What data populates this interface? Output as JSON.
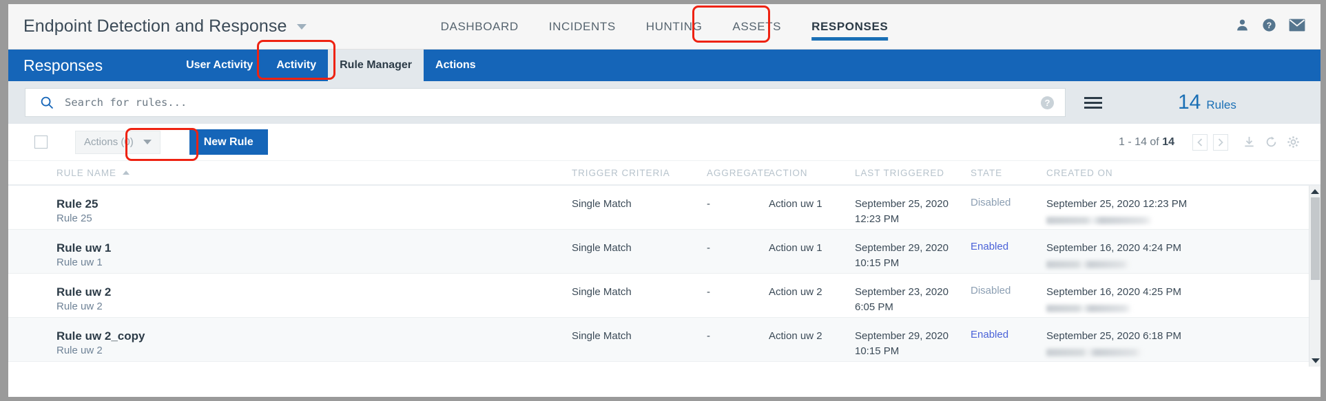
{
  "header": {
    "brand_title": "Endpoint Detection and Response",
    "brand_caret_icon": "chevron-down-icon",
    "nav": [
      {
        "label": "DASHBOARD",
        "active": false
      },
      {
        "label": "INCIDENTS",
        "active": false
      },
      {
        "label": "HUNTING",
        "active": false
      },
      {
        "label": "ASSETS",
        "active": false
      },
      {
        "label": "RESPONSES",
        "active": true
      }
    ],
    "icons": [
      {
        "name": "user-icon"
      },
      {
        "name": "help-icon"
      },
      {
        "name": "mail-icon"
      }
    ]
  },
  "subnav": {
    "title": "Responses",
    "tabs": [
      {
        "label": "User Activity",
        "active": false
      },
      {
        "label": "Activity",
        "active": false
      },
      {
        "label": "Rule Manager",
        "active": true
      },
      {
        "label": "Actions",
        "active": false
      }
    ]
  },
  "search": {
    "placeholder": "Search for rules...",
    "value": "",
    "icon": "search-icon",
    "help_label": "?",
    "menu_icon": "hamburger-icon"
  },
  "rules_counter": {
    "count": "14",
    "label": "Rules"
  },
  "toolbar": {
    "select_all_checkbox": "",
    "actions_label": "Actions (0)",
    "actions_caret_icon": "chevron-down-icon",
    "new_rule_label": "New Rule"
  },
  "pager": {
    "range_prefix": "1 - 14 of ",
    "total": "14",
    "prev_icon": "chevron-left-icon",
    "next_icon": "chevron-right-icon",
    "download_icon": "download-icon",
    "refresh_icon": "refresh-icon",
    "settings_icon": "gear-icon"
  },
  "table": {
    "columns": [
      {
        "key": "name",
        "label": "RULE NAME",
        "sorted": true
      },
      {
        "key": "trigger",
        "label": "TRIGGER CRITERIA",
        "sorted": false
      },
      {
        "key": "agg",
        "label": "AGGREGATE",
        "sorted": false
      },
      {
        "key": "action",
        "label": "ACTION",
        "sorted": false
      },
      {
        "key": "last",
        "label": "LAST TRIGGERED",
        "sorted": false
      },
      {
        "key": "state",
        "label": "STATE",
        "sorted": false
      },
      {
        "key": "created",
        "label": "CREATED ON",
        "sorted": false
      }
    ],
    "sort_caret_icon": "sort-asc-icon",
    "rows": [
      {
        "name": "Rule 25",
        "subtitle": "Rule 25",
        "trigger": "Single Match",
        "aggregate": "-",
        "action": "Action uw 1",
        "last_triggered_date": "September 25, 2020",
        "last_triggered_time": "12:23 PM",
        "state": "Disabled",
        "created_on": "September 25, 2020 12:23 PM",
        "created_by_redacted": true
      },
      {
        "name": "Rule uw 1",
        "subtitle": "Rule uw 1",
        "trigger": "Single Match",
        "aggregate": "-",
        "action": "Action uw 1",
        "last_triggered_date": "September 29, 2020",
        "last_triggered_time": "10:15 PM",
        "state": "Enabled",
        "created_on": "September 16, 2020 4:24 PM",
        "created_by_redacted": true
      },
      {
        "name": "Rule uw 2",
        "subtitle": "Rule uw 2",
        "trigger": "Single Match",
        "aggregate": "-",
        "action": "Action uw 2",
        "last_triggered_date": "September 23, 2020",
        "last_triggered_time": "6:05 PM",
        "state": "Disabled",
        "created_on": "September 16, 2020 4:25 PM",
        "created_by_redacted": true
      },
      {
        "name": "Rule uw 2_copy",
        "subtitle": "Rule uw 2",
        "trigger": "Single Match",
        "aggregate": "-",
        "action": "Action uw 2",
        "last_triggered_date": "September 29, 2020",
        "last_triggered_time": "10:15 PM",
        "state": "Enabled",
        "created_on": "September 25, 2020 6:18 PM",
        "created_by_redacted": true
      }
    ]
  },
  "scrollbar": {
    "up_icon": "triangle-up-icon",
    "down_icon": "triangle-down-icon"
  },
  "colors": {
    "brand_blue": "#1565b8",
    "accent_blue": "#1a6fb5",
    "highlight_red": "#ee2211",
    "state_enabled": "#4a62d8",
    "state_disabled": "#8c9fb3",
    "subnav_bg": "#1565b8",
    "search_bg": "#e3e8ec"
  }
}
